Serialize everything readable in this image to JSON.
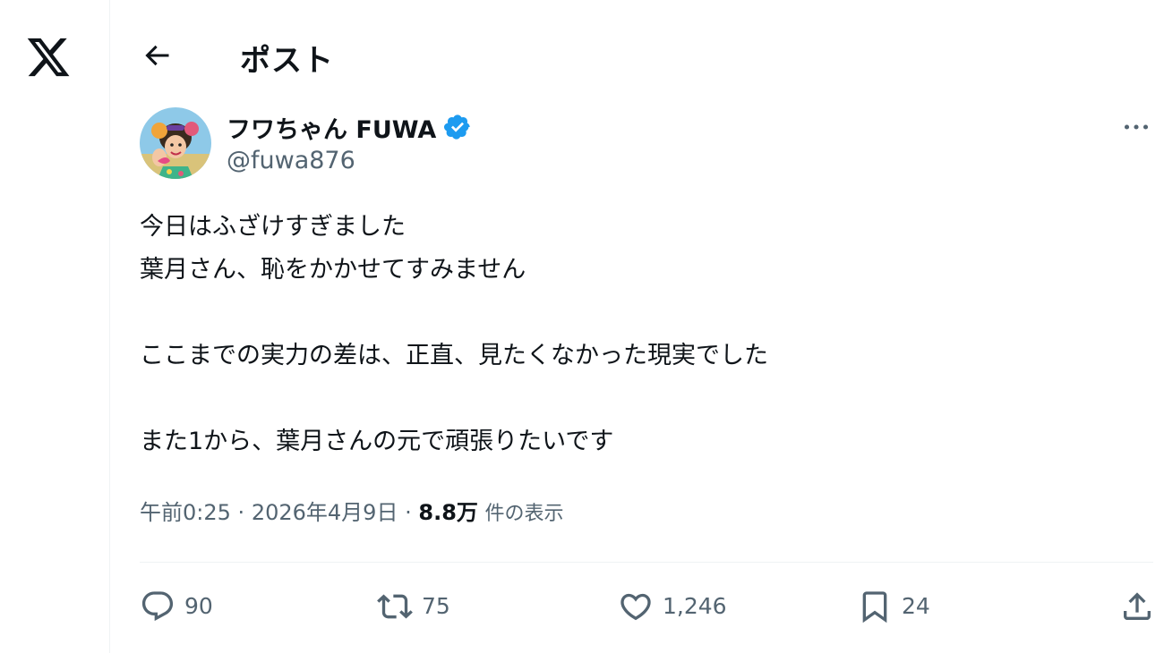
{
  "header": {
    "title": "ポスト"
  },
  "author": {
    "display_name": "フワちゃん FUWA",
    "handle": "@fuwa876",
    "verified": true
  },
  "tweet": {
    "lines": [
      "今日はふざけすぎました",
      "葉月さん、恥をかかせてすみません",
      "",
      "ここまでの実力の差は、正直、見たくなかった現実でした",
      "",
      "また1から、葉月さんの元で頑張りたいです"
    ]
  },
  "meta": {
    "time": "午前0:25",
    "separator": "·",
    "date": "2026年4月9日",
    "views_count": "8.8万",
    "views_label": "件の表示"
  },
  "actions": {
    "replies": "90",
    "reposts": "75",
    "likes": "1,246",
    "bookmarks": "24"
  },
  "colors": {
    "text": "#0f1419",
    "secondary": "#536471",
    "verified_blue": "#1d9bf0",
    "divider": "#eff3f4"
  },
  "icons": {
    "logo": "x-logo-icon",
    "back": "arrow-left-icon",
    "verified": "verified-badge-icon",
    "more": "more-horizontal-icon",
    "reply": "reply-icon",
    "repost": "repost-icon",
    "like": "heart-icon",
    "bookmark": "bookmark-icon",
    "share": "share-icon"
  }
}
